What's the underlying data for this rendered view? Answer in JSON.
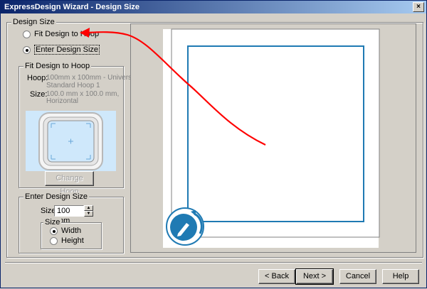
{
  "window": {
    "title": "ExpressDesign Wizard - Design Size",
    "close_glyph": "×"
  },
  "design_size_group": {
    "legend": "Design Size",
    "fit_option_label": "Fit Design to Hoop",
    "enter_option_label": "Enter Design Size",
    "selected": "enter"
  },
  "fit_group": {
    "legend": "Fit Design to Hoop",
    "hoop_label": "Hoop:",
    "hoop_value_line1": "100mm x 100mm - Universal",
    "hoop_value_line2": "Standard Hoop 1",
    "size_label": "Size:",
    "size_value_line1": "100.0 mm x 100.0 mm,",
    "size_value_line2": "Horizontal",
    "change_hoop_label": "Change Hoop"
  },
  "enter_group": {
    "legend": "Enter Design Size",
    "size_label": "Size",
    "size_value": "100 mm",
    "size_subgroup_legend": "Size",
    "width_label": "Width",
    "height_label": "Height",
    "selected": "width"
  },
  "buttons": {
    "back": "< Back",
    "next": "Next >",
    "cancel": "Cancel",
    "help": "Help"
  },
  "colors": {
    "annotation_arrow": "#ff0000",
    "design_rect": "#1f7ab3",
    "hoop_background": "#cfe8fb"
  },
  "icons": {
    "preview_badge": "rotate-pencil-icon"
  }
}
